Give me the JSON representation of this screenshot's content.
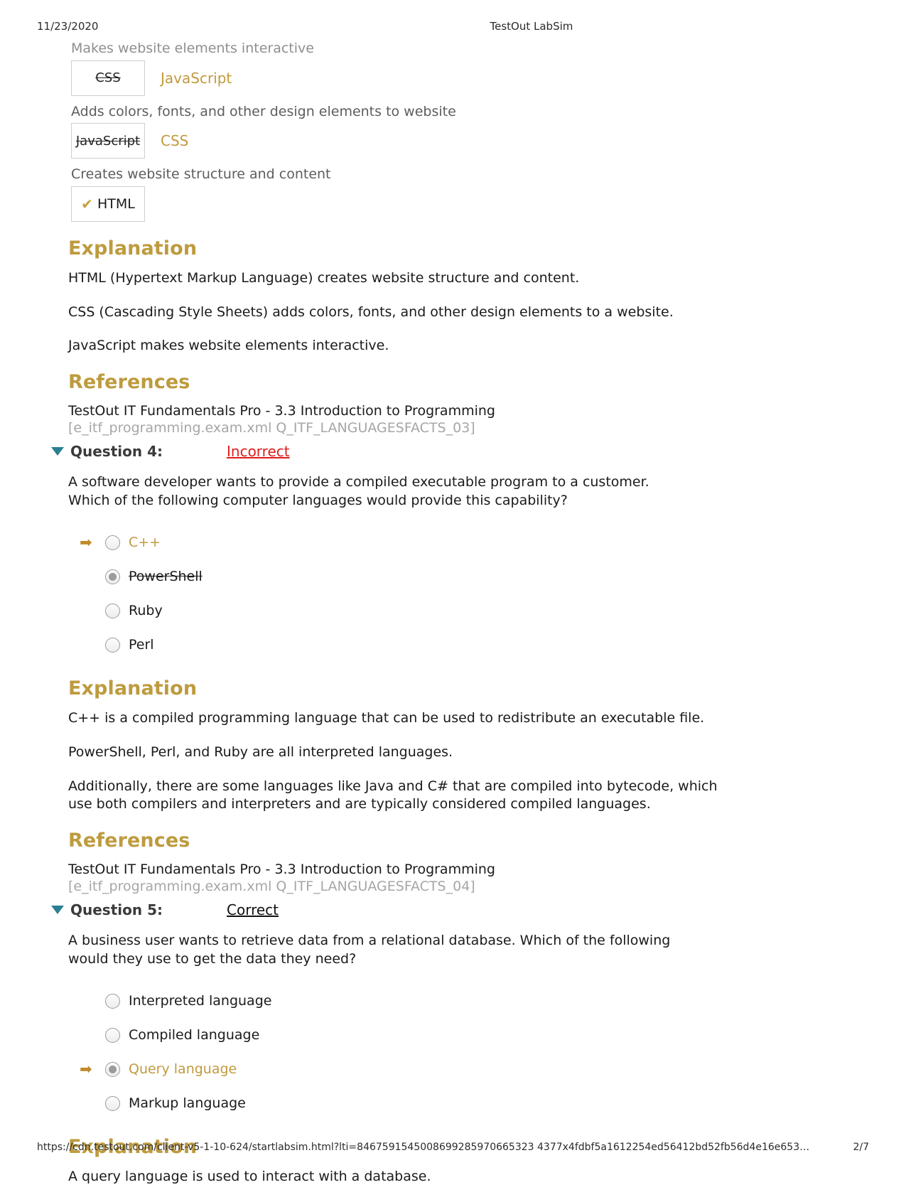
{
  "print_header": {
    "date": "11/23/2020",
    "title": "TestOut LabSim"
  },
  "matching_question": {
    "items": [
      {
        "prompt": "Makes website elements interactive",
        "dropped_answer": "CSS",
        "dropped_state": "wrong",
        "correct_answer": "JavaScript"
      },
      {
        "prompt": "Adds colors, fonts, and other design elements to website",
        "dropped_answer": "JavaScript",
        "dropped_state": "wrong",
        "correct_answer": "CSS"
      },
      {
        "prompt": "Creates website structure and content",
        "dropped_answer": "HTML",
        "dropped_state": "correct",
        "correct_answer": ""
      }
    ],
    "check_icon": "check-mark-icon",
    "explanation": {
      "heading": "Explanation",
      "paragraphs": [
        "HTML (Hypertext Markup Language) creates website structure and content.",
        "CSS (Cascading Style Sheets) adds colors, fonts, and other design elements to a website.",
        "JavaScript makes website elements interactive."
      ]
    },
    "references": {
      "heading": "References",
      "title": "TestOut IT Fundamentals Pro - 3.3 Introduction to Programming",
      "id": "[e_itf_programming.exam.xml Q_ITF_LANGUAGESFACTS_03]"
    }
  },
  "question_4": {
    "label": "Question 4:",
    "status": "Incorrect",
    "status_type": "incorrect",
    "toggle_icon": "triangle-down-icon",
    "text": "A software developer wants to provide a compiled executable program to a customer. Which of the following computer languages would provide this capability?",
    "options": [
      {
        "label": "C++",
        "selected": false,
        "correct": true,
        "struck": false
      },
      {
        "label": "PowerShell",
        "selected": true,
        "correct": false,
        "struck": true
      },
      {
        "label": "Ruby",
        "selected": false,
        "correct": false,
        "struck": false
      },
      {
        "label": "Perl",
        "selected": false,
        "correct": false,
        "struck": false
      }
    ],
    "arrow_icon": "arrow-right-icon",
    "explanation": {
      "heading": "Explanation",
      "paragraphs": [
        "C++ is a compiled programming language that can be used to redistribute an executable file.",
        "PowerShell, Perl, and Ruby are all interpreted languages.",
        "Additionally, there are some languages like Java and C# that are compiled into bytecode, which use both compilers and interpreters and are typically considered compiled languages."
      ]
    },
    "references": {
      "heading": "References",
      "title": "TestOut IT Fundamentals Pro - 3.3 Introduction to Programming",
      "id": "[e_itf_programming.exam.xml Q_ITF_LANGUAGESFACTS_04]"
    }
  },
  "question_5": {
    "label": "Question 5:",
    "status": "Correct",
    "status_type": "correct",
    "toggle_icon": "triangle-down-icon",
    "text": "A business user wants to retrieve data from a relational database. Which of the following would they use to get the data they need?",
    "options": [
      {
        "label": "Interpreted language",
        "selected": false,
        "correct": false,
        "struck": false
      },
      {
        "label": "Compiled language",
        "selected": false,
        "correct": false,
        "struck": false
      },
      {
        "label": "Query language",
        "selected": true,
        "correct": true,
        "struck": false
      },
      {
        "label": "Markup language",
        "selected": false,
        "correct": false,
        "struck": false
      }
    ],
    "arrow_icon": "arrow-right-icon",
    "explanation": {
      "heading": "Explanation",
      "paragraphs": [
        "A query language is used to interact with a database."
      ]
    }
  },
  "print_footer": {
    "url": "https://cdn.testout.com/client-v5-1-10-624/startlabsim.html?lti=8467591545008699285970665323 4377x4fdbf5a1612254ed56412bd52fb56d4e16e653…",
    "page": "2/7"
  },
  "colors": {
    "gold": "#c09a3e",
    "heading_gold": "#bd9b3e",
    "incorrect_red": "#e01b1b",
    "toggle_teal": "#2a7f92",
    "muted_gray": "#a6a6a6"
  }
}
